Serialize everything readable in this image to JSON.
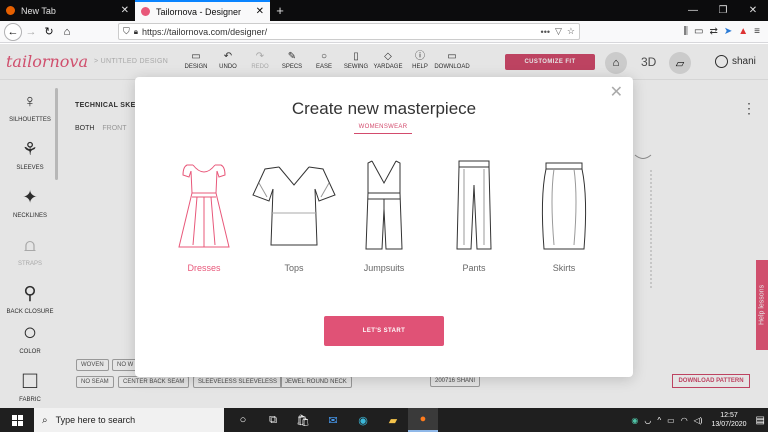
{
  "browser": {
    "tabs": [
      {
        "title": "New Tab",
        "active": false
      },
      {
        "title": "Tailornova - Designer",
        "active": true
      }
    ],
    "url": "https://tailornova.com/designer/"
  },
  "app": {
    "logo": "tailornova",
    "crumb": "> UNTITLED DESIGN",
    "toolbar": [
      {
        "label": "DESIGN",
        "icon": "document-icon",
        "glyph": "▭",
        "enabled": true
      },
      {
        "label": "UNDO",
        "icon": "undo-icon",
        "glyph": "↶",
        "enabled": true
      },
      {
        "label": "REDO",
        "icon": "redo-icon",
        "glyph": "↷",
        "enabled": false
      },
      {
        "label": "SPECS",
        "icon": "ruler-icon",
        "glyph": "✎",
        "enabled": true
      },
      {
        "label": "EASE",
        "icon": "circle-icon",
        "glyph": "○",
        "enabled": true
      },
      {
        "label": "SEWING",
        "icon": "book-icon",
        "glyph": "▯",
        "enabled": true
      },
      {
        "label": "YARDAGE",
        "icon": "fabric-icon",
        "glyph": "◇",
        "enabled": true
      },
      {
        "label": "HELP",
        "icon": "help-icon",
        "glyph": "ⓘ",
        "enabled": true
      },
      {
        "label": "DOWNLOAD",
        "icon": "download-icon",
        "glyph": "▭",
        "enabled": true
      }
    ],
    "customize_fit": "CUSTOMIZE FIT",
    "view_3d": "3D",
    "user": "shani"
  },
  "sidebar": [
    {
      "label": "SILHOUETTES",
      "icon": "dress-silhouette-icon",
      "enabled": true
    },
    {
      "label": "SLEEVES",
      "icon": "sleeves-icon",
      "enabled": true
    },
    {
      "label": "NECKLINES",
      "icon": "neckline-icon",
      "enabled": true
    },
    {
      "label": "STRAPS",
      "icon": "straps-icon",
      "enabled": false
    },
    {
      "label": "BACK CLOSURE",
      "icon": "back-closure-icon",
      "enabled": true
    },
    {
      "label": "COLOR",
      "icon": "color-circle-icon",
      "enabled": true
    },
    {
      "label": "FABRIC",
      "icon": "fabric-square-icon",
      "enabled": true
    }
  ],
  "workspace": {
    "section_title": "TECHNICAL SKET",
    "views": [
      "BOTH",
      "FRONT"
    ],
    "chips_row1": [
      "WOVEN",
      "NO W"
    ],
    "chips_row2": [
      "NO SEAM",
      "CENTER BACK SEAM",
      "SLEEVELESS SLEEVELESS",
      "JEWEL ROUND NECK"
    ],
    "size_chip": "200716 SHANI",
    "download_pattern": "DOWNLOAD PATTERN",
    "help_tab": "Help lessons"
  },
  "modal": {
    "title": "Create new masterpiece",
    "category_tab": "WOMENSWEAR",
    "garments": [
      {
        "label": "Dresses",
        "selected": true
      },
      {
        "label": "Tops",
        "selected": false
      },
      {
        "label": "Jumpsuits",
        "selected": false
      },
      {
        "label": "Pants",
        "selected": false
      },
      {
        "label": "Skirts",
        "selected": false
      }
    ],
    "start_button": "LET'S START"
  },
  "taskbar": {
    "search_placeholder": "Type here to search",
    "time": "12:57",
    "date": "13/07/2020"
  },
  "colors": {
    "accent": "#e05276",
    "logo": "#e8587a",
    "taskbar": "#1f1f1f"
  }
}
